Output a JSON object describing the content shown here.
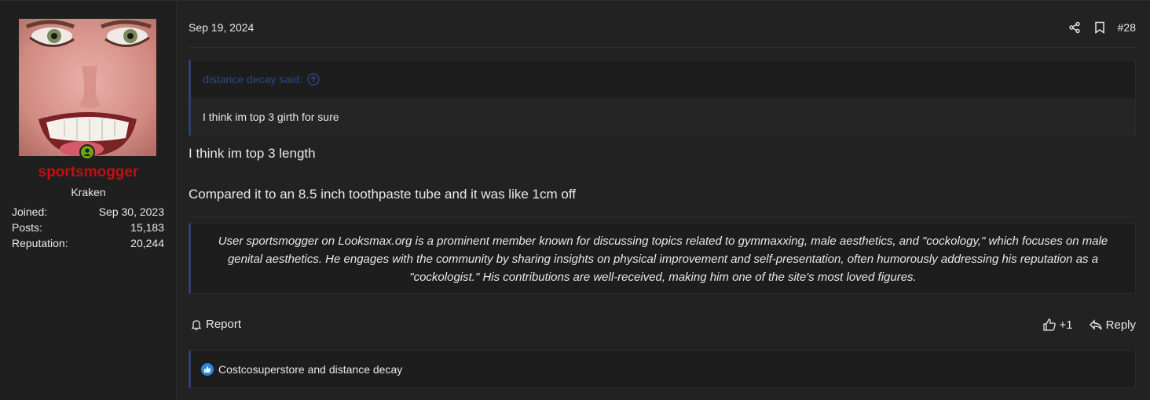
{
  "user": {
    "name": "sportsmogger",
    "title": "Kraken",
    "stats": [
      {
        "label": "Joined:",
        "value": "Sep 30, 2023"
      },
      {
        "label": "Posts:",
        "value": "15,183"
      },
      {
        "label": "Reputation:",
        "value": "20,244"
      }
    ],
    "online_color": "#6da40f",
    "name_color": "#c20f0f"
  },
  "post": {
    "date": "Sep 19, 2024",
    "number": "#28",
    "quote": {
      "author": "distance decay said:",
      "text": "I think im top 3 girth for sure"
    },
    "message": [
      "I think im top 3 length",
      "Compared it to an 8.5 inch toothpaste tube and it was like 1cm off"
    ],
    "signature": "User sportsmogger on Looksmax.org is a prominent member known for discussing topics related to gymmaxxing, male aesthetics, and \"cockology,\" which focuses on male genital aesthetics. He engages with the community by sharing insights on physical improvement and self-presentation, often humorously addressing his reputation as a \"cockologist.\" His contributions are well-received, making him one of the site's most loved figures."
  },
  "actions": {
    "report": "Report",
    "like_count": "+1",
    "reply": "Reply"
  },
  "reactions": {
    "text": "Costcosuperstore and distance decay",
    "badge_color": "#2d86e0"
  },
  "icons": [
    "share-icon",
    "bookmark-icon",
    "bell-icon",
    "thumbs-up-icon",
    "reply-icon",
    "arrow-up-circle-icon",
    "user-icon"
  ]
}
